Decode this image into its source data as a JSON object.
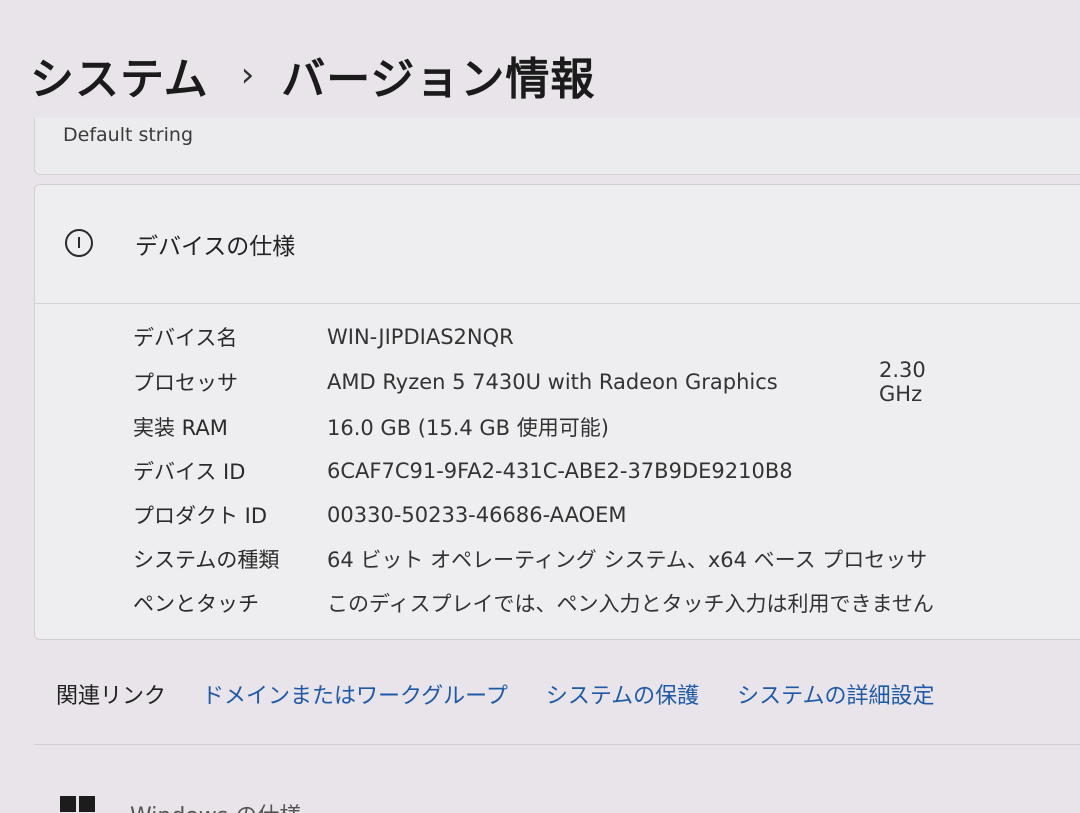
{
  "breadcrumb": {
    "parent": "システム",
    "separator": "›",
    "current": "バージョン情報"
  },
  "previous_card": {
    "text": "Default string"
  },
  "device_spec": {
    "title": "デバイスの仕様",
    "icon": "info-icon",
    "rows": [
      {
        "label": "デバイス名",
        "value": "WIN-JIPDIAS2NQR"
      },
      {
        "label": "プロセッサ",
        "value": "AMD Ryzen 5 7430U with Radeon Graphics",
        "extra": "2.30 GHz"
      },
      {
        "label": "実装 RAM",
        "value": "16.0 GB (15.4 GB 使用可能)"
      },
      {
        "label": "デバイス ID",
        "value": "6CAF7C91-9FA2-431C-ABE2-37B9DE9210B8"
      },
      {
        "label": "プロダクト ID",
        "value": "00330-50233-46686-AAOEM"
      },
      {
        "label": "システムの種類",
        "value": "64 ビット オペレーティング システム、x64 ベース プロセッサ"
      },
      {
        "label": "ペンとタッチ",
        "value": "このディスプレイでは、ペン入力とタッチ入力は利用できません"
      }
    ]
  },
  "related_links": {
    "label": "関連リンク",
    "links": [
      "ドメインまたはワークグループ",
      "システムの保護",
      "システムの詳細設定"
    ]
  },
  "windows_spec": {
    "title": "Windows の仕様",
    "icon": "windows-logo-icon"
  },
  "colors": {
    "link": "#1e5aa8",
    "background": "#e9e4ea",
    "card": "#eeeef0"
  }
}
